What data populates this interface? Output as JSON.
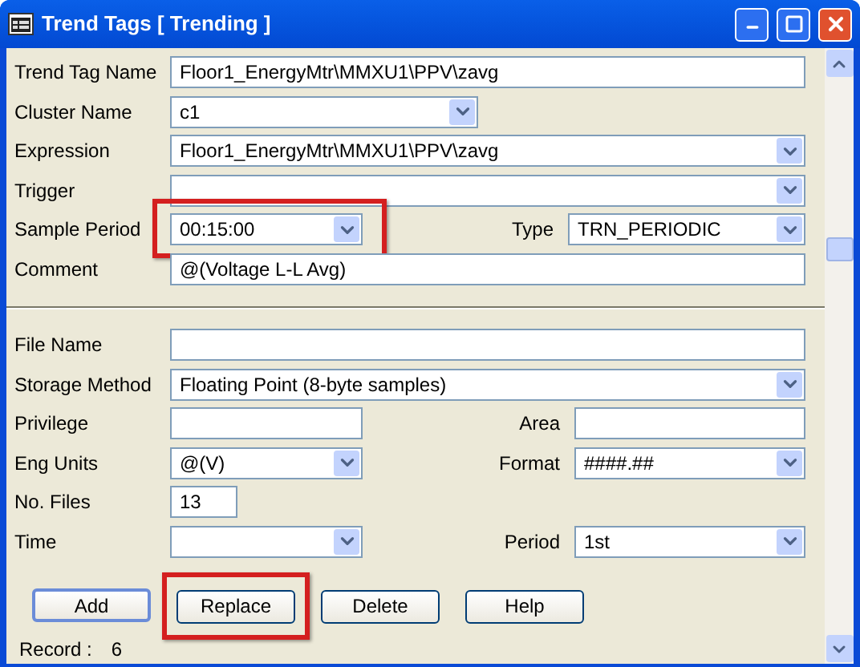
{
  "window": {
    "title": "Trend Tags [ Trending ]"
  },
  "top_rows": [
    [
      {
        "label": "Trend Tag Name",
        "value": "Floor1_EnergyMtr\\MMXU1\\PPV\\zavg",
        "kind": "text"
      }
    ],
    [
      {
        "label": "Cluster Name",
        "value": "c1",
        "kind": "combo"
      }
    ],
    [
      {
        "label": "Expression",
        "value": "Floor1_EnergyMtr\\MMXU1\\PPV\\zavg",
        "kind": "combo"
      }
    ],
    [
      {
        "label": "Trigger",
        "kind": "combo"
      }
    ],
    [
      {
        "label": "Sample Period",
        "value": "00:15:00",
        "kind": "combo",
        "highlighted": true
      },
      {
        "label": "Type",
        "value": "TRN_PERIODIC",
        "kind": "combo"
      }
    ],
    [
      {
        "label": "Comment",
        "value": "@(Voltage L-L Avg)",
        "kind": "text"
      }
    ]
  ],
  "bottom_rows": [
    [
      {
        "label": "File Name",
        "kind": "text"
      }
    ],
    [
      {
        "label": "Storage Method",
        "value": "Floating Point (8-byte samples)",
        "kind": "combo"
      }
    ],
    [
      {
        "label": "Privilege",
        "kind": "text"
      },
      {
        "label": "Area",
        "kind": "text"
      }
    ],
    [
      {
        "label": "Eng Units",
        "value": "@(V)",
        "kind": "combo"
      },
      {
        "label": "Format",
        "value": "####.##",
        "kind": "combo"
      }
    ],
    [
      {
        "label": "No. Files",
        "value": "13",
        "kind": "text"
      }
    ],
    [
      {
        "label": "Time",
        "kind": "combo"
      },
      {
        "label": "Period",
        "value": "1st",
        "kind": "combo"
      }
    ]
  ],
  "buttons": [
    {
      "label": "Add",
      "default": true
    },
    {
      "label": "Replace",
      "default": false,
      "highlighted": true
    },
    {
      "label": "Delete",
      "default": false
    },
    {
      "label": "Help",
      "default": false
    }
  ],
  "status": {
    "label": "Record :",
    "value": "6"
  }
}
